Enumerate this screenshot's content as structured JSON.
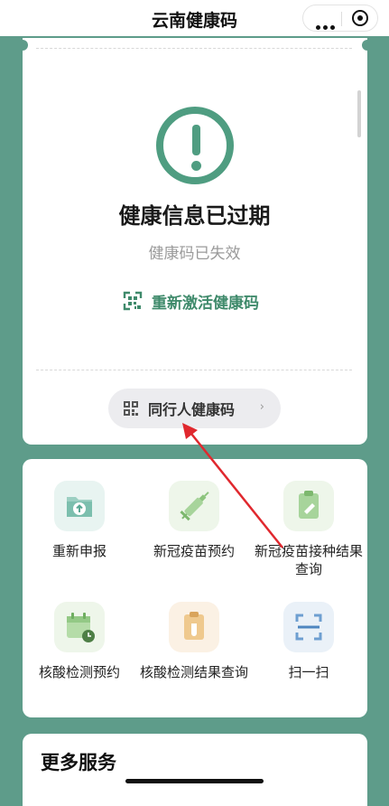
{
  "header": {
    "title": "云南健康码",
    "more_icon": "more-dots-icon",
    "close_icon": "target-close-icon"
  },
  "status": {
    "icon": "exclamation-circle-icon",
    "title": "健康信息已过期",
    "subtitle": "健康码已失效",
    "action_label": "重新激活健康码",
    "accent_color": "#4f9d81"
  },
  "companion": {
    "label": "同行人健康码",
    "chevron": "›"
  },
  "services": [
    {
      "label": "重新申报",
      "icon": "upload-folder-icon"
    },
    {
      "label": "新冠疫苗预约",
      "icon": "syringe-icon"
    },
    {
      "label": "新冠疫苗接种结果查询",
      "icon": "clipboard-vaccine-icon"
    },
    {
      "label": "核酸检测预约",
      "icon": "calendar-clock-icon"
    },
    {
      "label": "核酸检测结果查询",
      "icon": "clipboard-test-tube-icon"
    },
    {
      "label": "扫一扫",
      "icon": "scan-icon"
    }
  ],
  "more": {
    "title": "更多服务"
  },
  "colors": {
    "background": "#5e9c8a",
    "annotation_arrow": "#e0282e"
  }
}
